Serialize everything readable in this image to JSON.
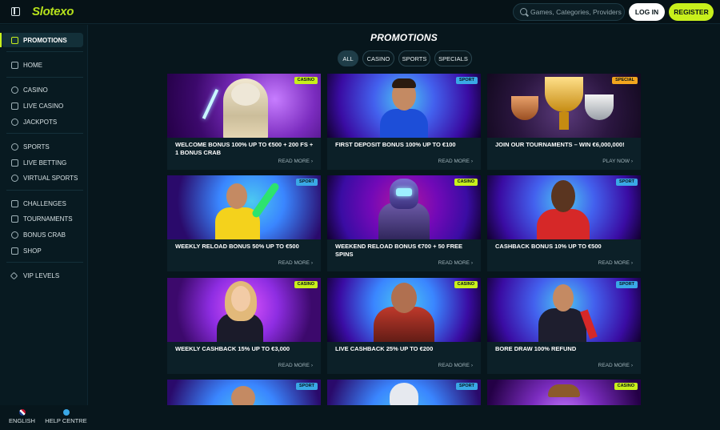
{
  "header": {
    "logo": "Slotexo",
    "search_placeholder": "Games, Categories, Providers",
    "login_label": "LOG IN",
    "register_label": "REGISTER"
  },
  "sidebar": {
    "items": [
      {
        "label": "PROMOTIONS",
        "icon": "gift-icon",
        "active": true
      },
      {
        "label": "HOME",
        "icon": "home-icon"
      },
      {
        "label": "CASINO",
        "icon": "chip-icon"
      },
      {
        "label": "LIVE CASINO",
        "icon": "spade-icon"
      },
      {
        "label": "JACKPOTS",
        "icon": "coin-icon"
      },
      {
        "label": "SPORTS",
        "icon": "ball-icon"
      },
      {
        "label": "LIVE BETTING",
        "icon": "screen-icon"
      },
      {
        "label": "VIRTUAL SPORTS",
        "icon": "globe-icon"
      },
      {
        "label": "CHALLENGES",
        "icon": "trophy-icon"
      },
      {
        "label": "TOURNAMENTS",
        "icon": "cup-icon"
      },
      {
        "label": "BONUS CRAB",
        "icon": "crab-icon"
      },
      {
        "label": "SHOP",
        "icon": "bag-icon"
      },
      {
        "label": "VIP LEVELS",
        "icon": "diamond-icon"
      }
    ],
    "footer": {
      "language_label": "ENGLISH",
      "help_label": "HELP CENTRE"
    }
  },
  "main": {
    "title": "PROMOTIONS",
    "filters": [
      "ALL",
      "CASINO",
      "SPORTS",
      "SPECIALS"
    ],
    "active_filter": "ALL",
    "cards": [
      {
        "badge": "CASINO",
        "title": "WELCOME BONUS 100% UP TO €500 + 200 FS + 1 BONUS CRAB",
        "cta": "READ MORE"
      },
      {
        "badge": "SPORT",
        "title": "FIRST DEPOSIT BONUS 100% UP TO €100",
        "cta": "READ MORE"
      },
      {
        "badge": "SPECIAL",
        "title": "JOIN OUR TOURNAMENTS – WIN €6,000,000!",
        "cta": "PLAY NOW"
      },
      {
        "badge": "SPORT",
        "title": "WEEKLY RELOAD BONUS 50% UP TO €500",
        "cta": "READ MORE"
      },
      {
        "badge": "CASINO",
        "title": "WEEKEND RELOAD BONUS €700 + 50 FREE SPINS",
        "cta": "READ MORE"
      },
      {
        "badge": "SPORT",
        "title": "CASHBACK BONUS 10% UP TO €500",
        "cta": "READ MORE"
      },
      {
        "badge": "CASINO",
        "title": "WEEKLY CASHBACK 15% UP TO €3,000",
        "cta": "READ MORE"
      },
      {
        "badge": "CASINO",
        "title": "LIVE CASHBACK 25% UP TO €200",
        "cta": "READ MORE"
      },
      {
        "badge": "SPORT",
        "title": "BORE DRAW 100% REFUND",
        "cta": "READ MORE"
      },
      {
        "badge": "SPORT",
        "title": "",
        "cta": ""
      },
      {
        "badge": "SPORT",
        "title": "",
        "cta": ""
      },
      {
        "badge": "CASINO",
        "title": "",
        "cta": ""
      }
    ]
  },
  "colors": {
    "accent": "#c8f01c",
    "casino_badge": "#c8f01c",
    "sport_badge": "#3aa8e6",
    "special_badge": "#f2a51e",
    "background": "#07161c"
  }
}
